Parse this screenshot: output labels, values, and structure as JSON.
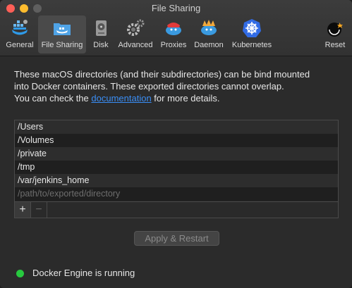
{
  "window": {
    "title": "File Sharing"
  },
  "toolbar": {
    "tabs": [
      {
        "label": "General",
        "icon": "general-icon"
      },
      {
        "label": "File Sharing",
        "icon": "file-sharing-icon",
        "active": true
      },
      {
        "label": "Disk",
        "icon": "disk-icon"
      },
      {
        "label": "Advanced",
        "icon": "advanced-icon"
      },
      {
        "label": "Proxies",
        "icon": "proxies-icon"
      },
      {
        "label": "Daemon",
        "icon": "daemon-icon"
      },
      {
        "label": "Kubernetes",
        "icon": "kubernetes-icon"
      }
    ],
    "reset": {
      "label": "Reset",
      "icon": "reset-icon"
    }
  },
  "description": {
    "line1": "These macOS directories (and their subdirectories) can be bind mounted",
    "line2": "into Docker containers. These exported directories cannot overlap.",
    "line3_prefix": "You can check the ",
    "link": "documentation",
    "line3_suffix": " for more details."
  },
  "directories": [
    "/Users",
    "/Volumes",
    "/private",
    "/tmp",
    "/var/jenkins_home"
  ],
  "new_path_placeholder": "/path/to/exported/directory",
  "list_buttons": {
    "add": "+",
    "remove": "−"
  },
  "apply_button": "Apply & Restart",
  "status": {
    "text": "Docker Engine is running",
    "color": "#27c93f"
  },
  "colors": {
    "accent": "#3a8ef6"
  }
}
